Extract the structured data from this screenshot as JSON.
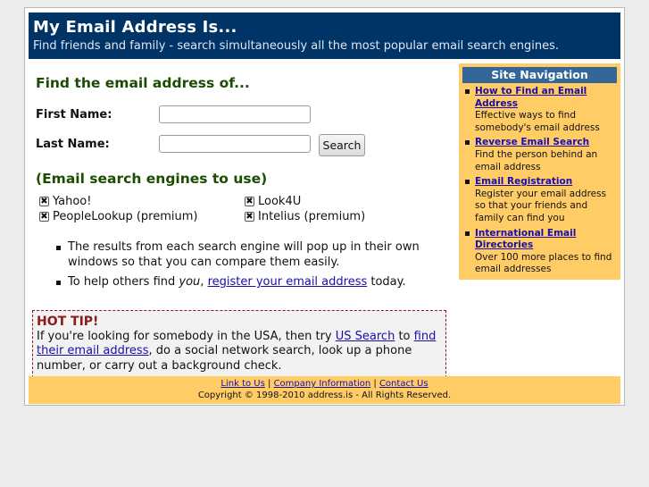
{
  "header": {
    "title": "My Email Address Is...",
    "subtitle": "Find friends and family - search simultaneously all the most popular email search engines."
  },
  "form": {
    "heading": "Find the email address of...",
    "first_name_label": "First Name:",
    "last_name_label": "Last Name:",
    "first_name_value": "",
    "last_name_value": "",
    "search_button": "Search"
  },
  "engines": {
    "heading": "(Email search engines to use)",
    "items": [
      {
        "label": "Yahoo!",
        "checked": true
      },
      {
        "label": "Look4U",
        "checked": true
      },
      {
        "label": "PeopleLookup (premium)",
        "checked": true
      },
      {
        "label": "Intelius (premium)",
        "checked": true
      }
    ]
  },
  "notes": {
    "note1": "The results from each search engine will pop up in their own windows so that you can compare them easily.",
    "note2_pre": "To help others find ",
    "note2_em": "you",
    "note2_mid": ", ",
    "note2_link": "register your email address",
    "note2_post": " today."
  },
  "tip": {
    "title": "HOT TIP!",
    "text_pre": "If you're looking for somebody in the USA, then try ",
    "link1": "US Search",
    "text_mid": " to ",
    "link2": "find their email address",
    "text_post": ", do a social network search, look up a phone number, or carry out a background check."
  },
  "nav": {
    "title": "Site Navigation",
    "items": [
      {
        "label": "How to Find an Email Address",
        "desc": "Effective ways to find somebody's email address"
      },
      {
        "label": "Reverse Email Search",
        "desc": "Find the person behind an email address"
      },
      {
        "label": "Email Registration",
        "desc": "Register your email address so that your friends and family can find you"
      },
      {
        "label": "International Email Directories",
        "desc": "Over 100 more places to find email addresses"
      }
    ]
  },
  "footer": {
    "links": [
      "Link to Us",
      "Company Information",
      "Contact Us"
    ],
    "separator": "|",
    "copyright": "Copyright © 1998-2010 address.is - All Rights Reserved."
  },
  "colors": {
    "header_bg": "#003366",
    "nav_bg": "#ffcc66",
    "nav_title_bg": "#336699",
    "heading_green": "#1a4d00",
    "tip_red": "#8b1a1a",
    "link_blue": "#1a0dab"
  },
  "icons": {
    "checkbox_checked": "checkbox-checked-icon"
  }
}
